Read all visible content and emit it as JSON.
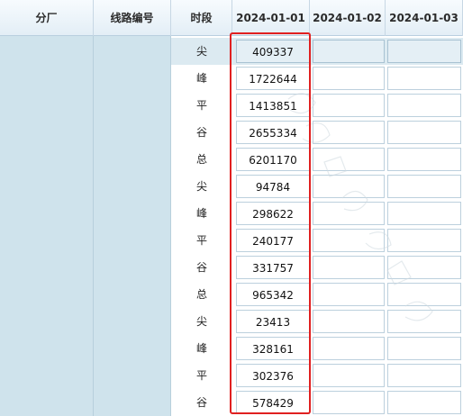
{
  "columns": [
    "分厂",
    "线路编号",
    "时段",
    "2024-01-01",
    "2024-01-02",
    "2024-01-03"
  ],
  "rows": [
    {
      "period": "尖",
      "d1": "409337",
      "d2": "",
      "d3": ""
    },
    {
      "period": "峰",
      "d1": "1722644",
      "d2": "",
      "d3": ""
    },
    {
      "period": "平",
      "d1": "1413851",
      "d2": "",
      "d3": ""
    },
    {
      "period": "谷",
      "d1": "2655334",
      "d2": "",
      "d3": ""
    },
    {
      "period": "总",
      "d1": "6201170",
      "d2": "",
      "d3": ""
    },
    {
      "period": "尖",
      "d1": "94784",
      "d2": "",
      "d3": ""
    },
    {
      "period": "峰",
      "d1": "298622",
      "d2": "",
      "d3": ""
    },
    {
      "period": "平",
      "d1": "240177",
      "d2": "",
      "d3": ""
    },
    {
      "period": "谷",
      "d1": "331757",
      "d2": "",
      "d3": ""
    },
    {
      "period": "总",
      "d1": "965342",
      "d2": "",
      "d3": ""
    },
    {
      "period": "尖",
      "d1": "23413",
      "d2": "",
      "d3": ""
    },
    {
      "period": "峰",
      "d1": "328161",
      "d2": "",
      "d3": ""
    },
    {
      "period": "平",
      "d1": "302376",
      "d2": "",
      "d3": ""
    },
    {
      "period": "谷",
      "d1": "578429",
      "d2": "",
      "d3": ""
    }
  ],
  "colors": {
    "highlight_box": "#e02020",
    "frozen_bg": "#cfe3ec",
    "header_bg": "#e3eef6"
  }
}
